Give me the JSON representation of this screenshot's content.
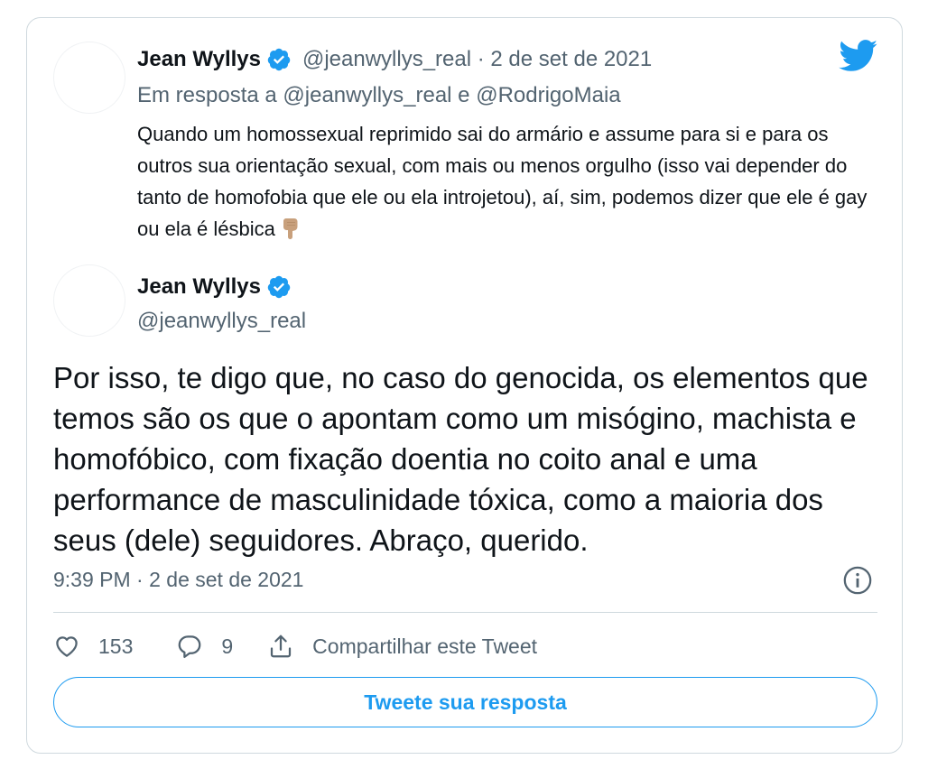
{
  "quoted_tweet": {
    "author_name": "Jean Wyllys",
    "handle": "@jeanwyllys_real",
    "date": "2 de set de 2021",
    "reply_prefix": "Em resposta a ",
    "reply_user_1": "@jeanwyllys_real",
    "reply_joiner": " e ",
    "reply_user_2": "@RodrigoMaia",
    "text": "Quando um homossexual reprimido sai do armário e assume para si e para os outros sua orientação sexual, com mais ou menos orgulho (isso vai depender do tanto de homofobia que ele ou ela introjetou), aí, sim, podemos dizer que ele é gay ou ela é lésbica",
    "emoji": "backhand-index-pointing-down"
  },
  "main_tweet": {
    "author_name": "Jean Wyllys",
    "handle": "@jeanwyllys_real",
    "text": "Por isso, te digo que, no caso do genocida, os elementos que temos são os que o apontam como um misógino, machista e homofóbico, com fixação doentia no coito anal e uma performance de masculinidade tóxica, como a maioria dos seus (dele) seguidores. Abraço, querido.",
    "time": "9:39 PM",
    "date": "2 de set de 2021"
  },
  "actions": {
    "likes": "153",
    "replies": "9",
    "share_label": "Compartilhar este Tweet"
  },
  "reply_button_label": "Tweete sua resposta",
  "colors": {
    "brand_blue": "#1d9bf0",
    "verified_blue": "#1d9bf0",
    "secondary_text": "#536471",
    "primary_text": "#0f1419",
    "border": "#cfd9de"
  }
}
